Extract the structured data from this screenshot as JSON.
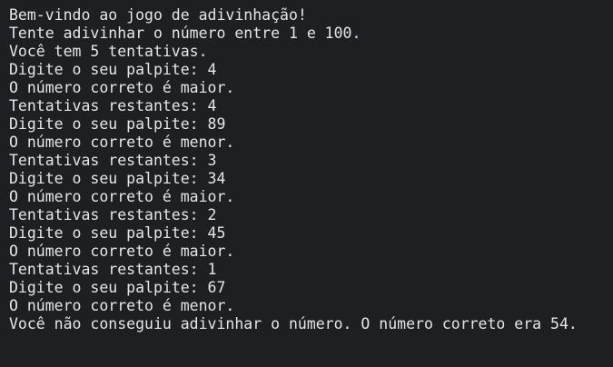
{
  "terminal": {
    "lines": [
      "Bem-vindo ao jogo de adivinhação!",
      "Tente adivinhar o número entre 1 e 100.",
      "Você tem 5 tentativas.",
      "Digite o seu palpite: 4",
      "O número correto é maior.",
      "Tentativas restantes: 4",
      "Digite o seu palpite: 89",
      "O número correto é menor.",
      "Tentativas restantes: 3",
      "Digite o seu palpite: 34",
      "O número correto é maior.",
      "Tentativas restantes: 2",
      "Digite o seu palpite: 45",
      "O número correto é maior.",
      "Tentativas restantes: 1",
      "Digite o seu palpite: 67",
      "O número correto é menor.",
      "Você não conseguiu adivinhar o número. O número correto era 54."
    ]
  },
  "colors": {
    "background": "#1e1f22",
    "text": "#e6e6e6"
  }
}
